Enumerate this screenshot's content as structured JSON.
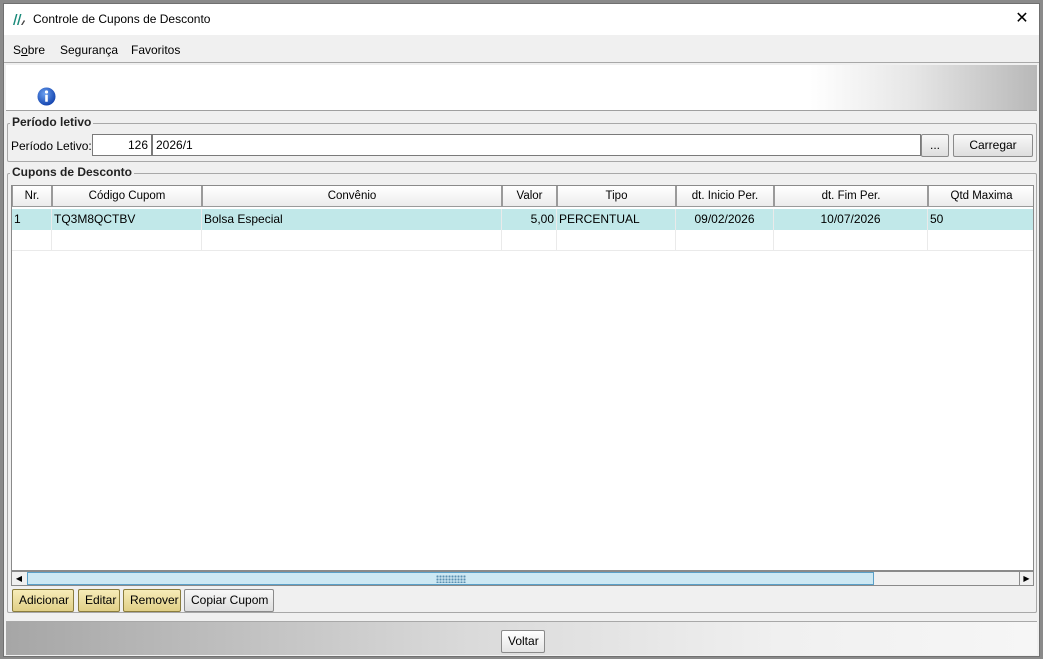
{
  "window": {
    "title": "Controle de Cupons de Desconto",
    "close_label": "✕"
  },
  "menu": [
    {
      "label": "Sobre",
      "mnemonic": "o"
    },
    {
      "label": "Segurança"
    },
    {
      "label": "Favoritos"
    }
  ],
  "periodo": {
    "group_title": "Período letivo",
    "label": "Período Letivo:",
    "code": "126",
    "description": "2026/1",
    "lookup_label": "...",
    "load_label": "Carregar"
  },
  "cupons": {
    "group_title": "Cupons de Desconto",
    "columns": [
      "Nr.",
      "Código Cupom",
      "Convênio",
      "Valor",
      "Tipo",
      "dt. Inicio Per.",
      "dt. Fim Per.",
      "Qtd Maxima"
    ],
    "rows": [
      {
        "nr": "1",
        "codigo": "TQ3M8QCTBV",
        "convenio": "Bolsa Especial",
        "valor": "5,00",
        "tipo": "PERCENTUAL",
        "inicio": "09/02/2026",
        "fim": "10/07/2026",
        "qtd": "50"
      }
    ],
    "actions": {
      "adicionar": "Adicionar",
      "editar": "Editar",
      "remover": "Remover",
      "copiar": "Copiar Cupom"
    }
  },
  "footer": {
    "voltar": "Voltar"
  },
  "colors": {
    "selected_row": "#c1e8e9",
    "action_button": "#e9dc9c"
  }
}
